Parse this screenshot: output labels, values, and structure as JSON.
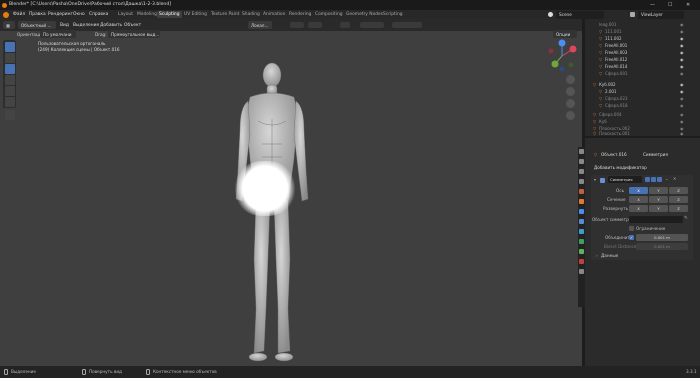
{
  "window": {
    "title": "Blender* [C:\\Users\\Pasha\\OneDrive\\Рабочий стол\\Дашка\\1-2-3.blend]"
  },
  "menu": {
    "items": [
      "Файл",
      "Правка",
      "Рендеринг",
      "Окно",
      "Справка"
    ]
  },
  "workspaces": [
    "Layout",
    "Modeling",
    "Sculpting",
    "UV Editing",
    "Texture Paint",
    "Shading",
    "Animation",
    "Rendering",
    "Compositing",
    "Geometry Nodes",
    "Scripting"
  ],
  "active_workspace": "Sculpting",
  "scene": {
    "name": "Scene",
    "view_layer": "ViewLayer"
  },
  "viewport_header": {
    "mode": "Объектный ...",
    "view": "Вид",
    "select": "Выделение",
    "add": "Добавить",
    "object": "Объект",
    "orientation_label": "Ориентация:",
    "orientation_value": "По умолчани",
    "drag_label": "Drag:",
    "drag_value": "Прямоугольное выд...",
    "transform_pivot": "Локал...",
    "options": "Опции"
  },
  "viewport": {
    "view_name": "Пользовательская ортогональ",
    "collection_info": "(249) Коллекция сцены | Объект.016"
  },
  "outliner": {
    "items": [
      {
        "name": "leag.001",
        "dim": true
      },
      {
        "name": "111.001",
        "dim": true
      },
      {
        "name": "111.002",
        "dim": false
      },
      {
        "name": "FreeAll.001",
        "dim": false
      },
      {
        "name": "FreeAll.003",
        "dim": false
      },
      {
        "name": "FreeAll.012",
        "dim": false
      },
      {
        "name": "FreeAll.014",
        "dim": false
      },
      {
        "name": "Сфера.001",
        "dim": true
      },
      {
        "name": "Куб.002",
        "dim": false
      },
      {
        "name": "2.001",
        "dim": false
      },
      {
        "name": "Сфера.023",
        "dim": true
      },
      {
        "name": "Сфера.018",
        "dim": true
      },
      {
        "name": "Сфера.004",
        "dim": true
      },
      {
        "name": "Куб",
        "dim": true
      },
      {
        "name": "Плоскость.002",
        "dim": true
      },
      {
        "name": "Плоскость.001",
        "dim": true
      }
    ]
  },
  "properties": {
    "object_name": "Объект.016",
    "modifier_tab": "Симметрия",
    "add_modifier": "Добавить модификатор",
    "modifier_name": "Симметрия",
    "axis_label": "Ось",
    "bisect_label": "Сечение",
    "flip_label": "Развернуть",
    "axes": [
      "X",
      "Y",
      "Z"
    ],
    "mirror_object_label": "Объект симметр...",
    "clipping_label": "Ограничение",
    "merge_label": "Объединить",
    "merge_value": "0.001 m",
    "bisect_distance_label": "Bisect Distance",
    "bisect_distance_value": "0.001 m",
    "data_label": "Данные"
  },
  "status": {
    "select": "Выделение",
    "rotate": "Повернуть вид",
    "context_menu": "Контекстное меню объектов",
    "version": "3.3.1"
  },
  "colors": {
    "accent": "#4772b3",
    "viewport_bg": "#3f3f3f",
    "panel_bg": "#2b2b2b",
    "header_bg": "#282828"
  }
}
